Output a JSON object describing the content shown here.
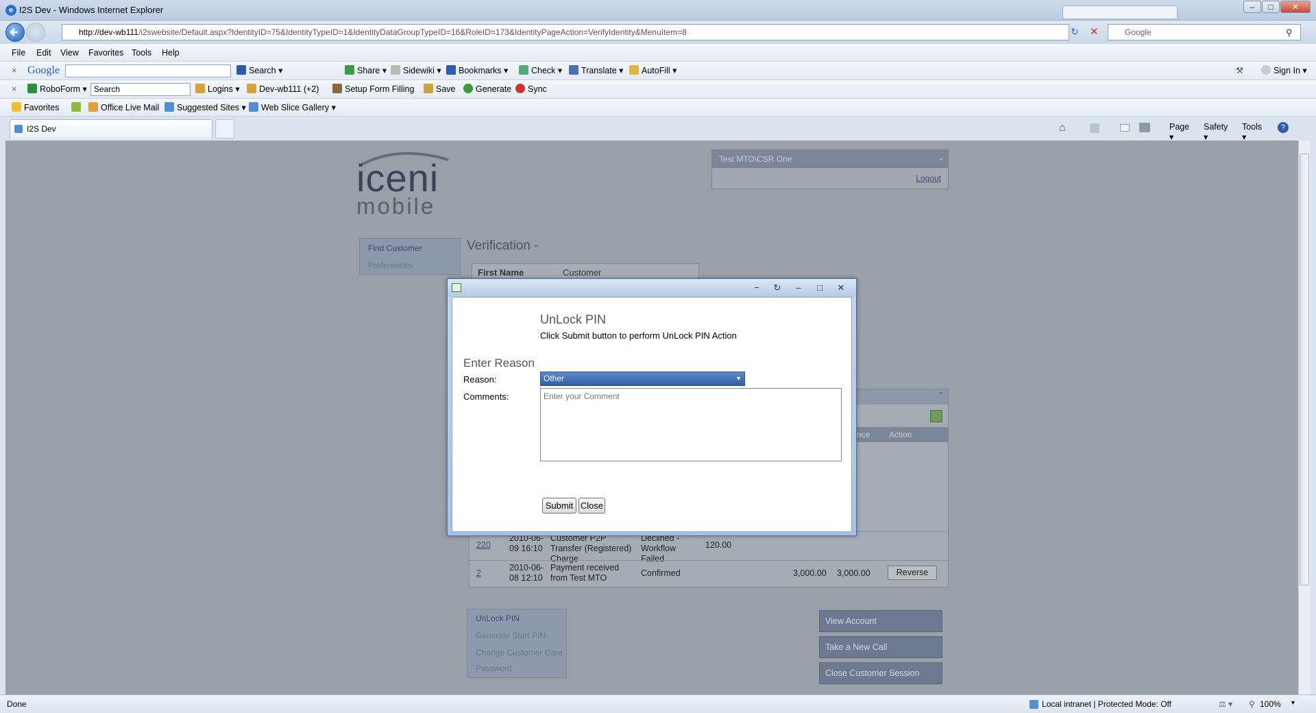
{
  "window": {
    "title": "I2S Dev - Windows Internet Explorer"
  },
  "address": {
    "url_host": "http://dev-wb111",
    "url_path": "/i2swebsite/Default.aspx?IdentityID=75&IdentityTypeID=1&IdentityDataGroupTypeID=16&RoleID=173&IdentityPageAction=VerifyIdentity&MenuItem=8",
    "search_placeholder": "Google"
  },
  "menubar": [
    "File",
    "Edit",
    "View",
    "Favorites",
    "Tools",
    "Help"
  ],
  "googlebar": {
    "brand": "Google",
    "items": [
      "Search",
      "Share",
      "Sidewiki",
      "Bookmarks",
      "Check",
      "Translate",
      "AutoFill"
    ],
    "sign_in": "Sign In"
  },
  "roboform": {
    "brand": "RoboForm",
    "search": "Search",
    "items": [
      "Logins",
      "Dev-wb111 (+2)",
      "Setup Form Filling",
      "Save",
      "Generate",
      "Sync"
    ]
  },
  "favbar": {
    "items": [
      "Favorites",
      "Office Live Mail",
      "Suggested Sites",
      "Web Slice Gallery"
    ]
  },
  "tab": {
    "label": "I2S Dev"
  },
  "cmdbar": {
    "items": [
      "Page",
      "Safety",
      "Tools"
    ]
  },
  "page": {
    "logo_top": "iceni",
    "logo_bottom": "mobile",
    "user": "Test MTO\\CSR One",
    "logout": "Logout",
    "nav": [
      "Find Customer",
      "Preferences"
    ],
    "verification_title": "Verification -",
    "first_name_label": "First Name",
    "first_name_value": "Customer",
    "grid_headers": [
      "nce",
      "Action"
    ],
    "rows": [
      {
        "id": "220",
        "date": "2010-06-09 16:10",
        "desc": "Customer P2P Transfer (Registered) Charge",
        "status": "Declined - Workflow Failed",
        "amount": "120.00",
        "c1": "",
        "c2": "",
        "action": ""
      },
      {
        "id": "2",
        "date": "2010-06-08 12:10",
        "desc": "Payment received from Test MTO",
        "status": "Confirmed",
        "amount": "",
        "c1": "3,000.00",
        "c2": "3,000.00",
        "action": "Reverse"
      }
    ],
    "actions": [
      "UnLock PIN",
      "Generate Start PIN",
      "Change Customer Care",
      "Password"
    ],
    "right_buttons": [
      "View Account",
      "Take a New Call",
      "Close Customer Session"
    ]
  },
  "modal": {
    "title": "UnLock PIN",
    "subtitle": "Click Submit button to perform UnLock PIN Action",
    "section": "Enter Reason",
    "reason_label": "Reason:",
    "reason_value": "Other",
    "comments_label": "Comments:",
    "comments_placeholder": "Enter your Comment",
    "submit": "Submit",
    "close": "Close"
  },
  "status": {
    "left": "Done",
    "zone": "Local intranet | Protected Mode: Off",
    "zoom": "100%"
  }
}
